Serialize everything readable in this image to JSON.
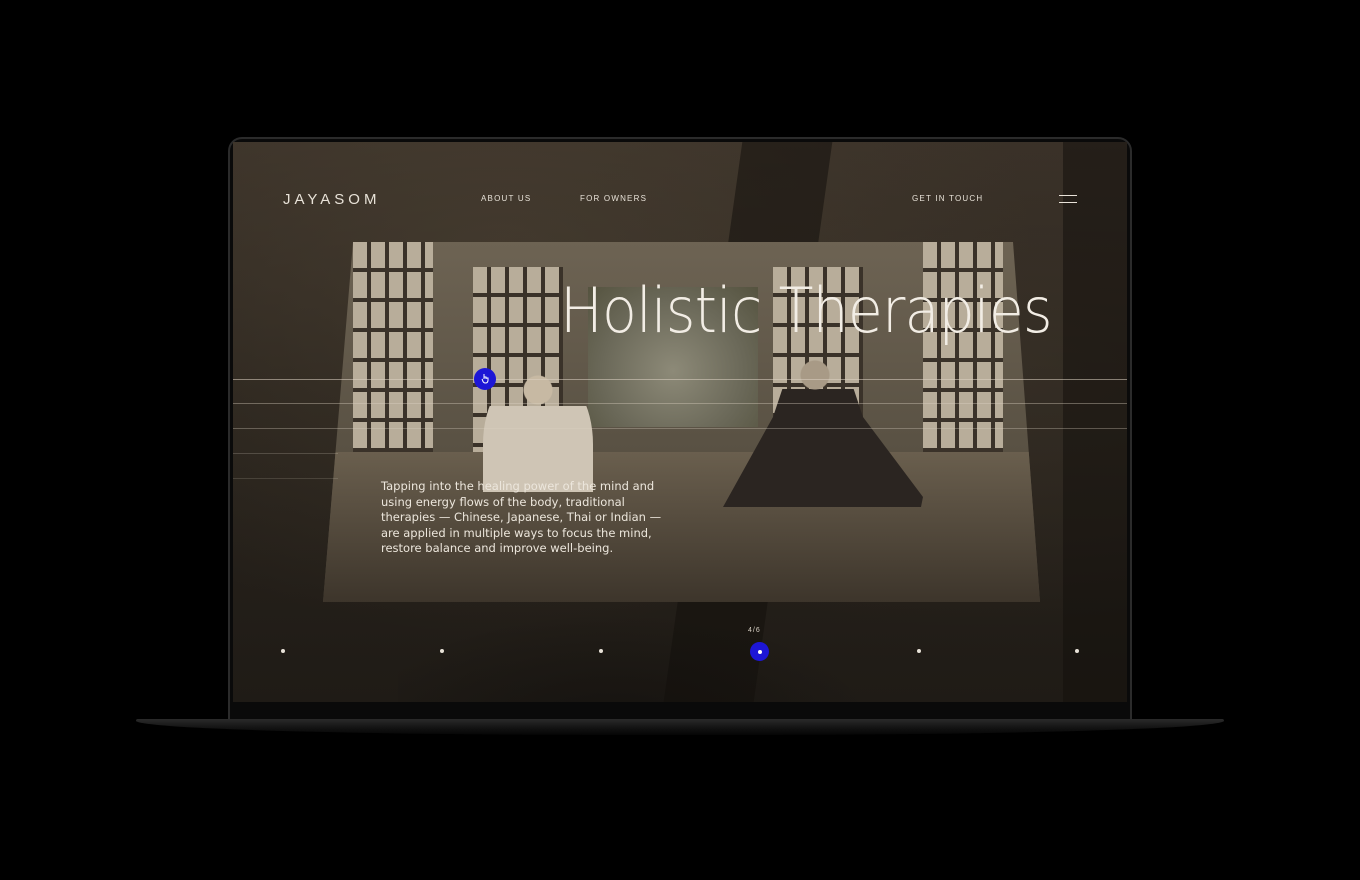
{
  "site": {
    "logo": "JAYASOM",
    "nav": {
      "about": "ABOUT US",
      "owners": "FOR OWNERS",
      "contact": "GET IN TOUCH"
    }
  },
  "hero": {
    "title": "Holistic Therapies",
    "description": "Tapping into the healing power of the mind and using energy flows of the body, traditional therapies — Chinese, Japanese, Thai or Indian — are applied in multiple ways to focus the mind, restore balance and improve well-being."
  },
  "pager": {
    "label": "4/6",
    "current": 4,
    "total": 6
  },
  "colors": {
    "accent": "#1d16d6",
    "text": "#e8e2d8",
    "background": "#2a241d"
  },
  "icons": {
    "menu": "hamburger-menu-icon",
    "cursor": "hand-pointer-icon"
  }
}
